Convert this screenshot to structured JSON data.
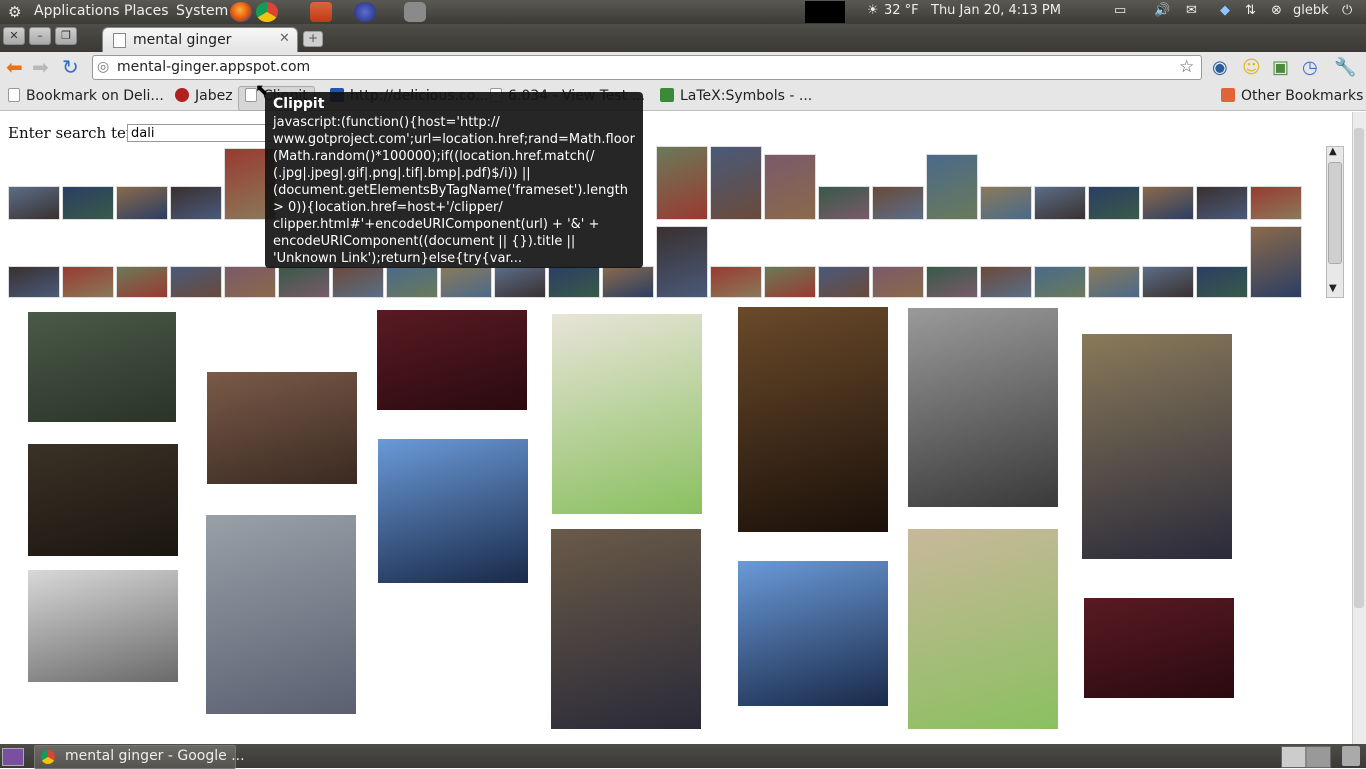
{
  "panel": {
    "menus": [
      "Applications",
      "Places",
      "System"
    ],
    "weather": "32 °F",
    "clock": "Thu Jan 20,  4:13 PM",
    "user": "glebk"
  },
  "browser": {
    "tab_title": "mental ginger",
    "url": "mental-ginger.appspot.com",
    "bookmarks": [
      {
        "label": "Bookmark on Deli...",
        "color": "#3d7ad6"
      },
      {
        "label": "Jabez",
        "color": "#b02020"
      },
      {
        "label": "Clippit",
        "color": "#d8d8d8"
      },
      {
        "label": "http://delicious.co...",
        "color": "#2255aa"
      },
      {
        "label": "6.034 - View Test ...",
        "color": "#777777"
      },
      {
        "label": "LaTeX:Symbols - ...",
        "color": "#3a8a3a"
      }
    ],
    "other_bookmarks": "Other Bookmarks"
  },
  "page": {
    "search_label": "Enter search term:",
    "search_value": "dali"
  },
  "tooltip": {
    "title": "Clippit",
    "body": "javascript:(function(){host='http://\nwww.gotproject.com';url=location.href;rand=Math.floor\n(Math.random()*100000);if((location.href.match(/\n(.jpg|.jpeg|.gif|.png|.tif|.bmp|.pdf)$/i)) ||\n(document.getElementsByTagName('frameset').length\n> 0)){location.href=host+'/clipper/\nclipper.html#'+encodeURIComponent(url) + '&' +\nencodeURIComponent((document || {}).title ||\n'Unknown Link');return}else{try{var..."
  },
  "taskbar": {
    "window_label": "mental ginger - Google ..."
  },
  "colors": {
    "panel": "#3c3b37",
    "toolbar": "#e6e6e6",
    "tooltip": "#141414"
  }
}
